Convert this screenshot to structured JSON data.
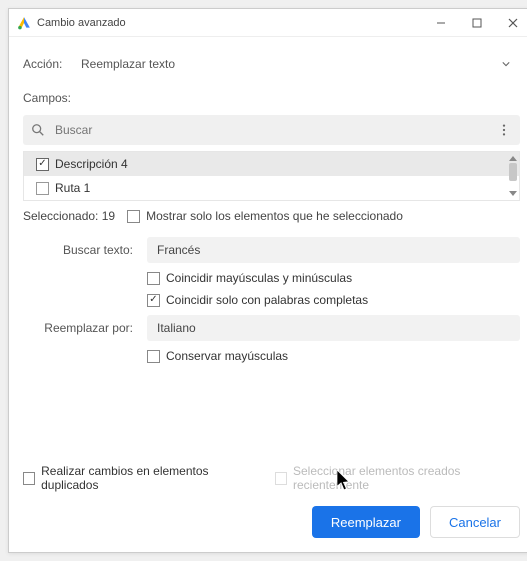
{
  "window": {
    "title": "Cambio avanzado"
  },
  "action": {
    "label": "Acción:",
    "value": "Reemplazar texto"
  },
  "fields": {
    "heading": "Campos:",
    "search_placeholder": "Buscar"
  },
  "list": {
    "items": [
      {
        "label": "Descripción 4",
        "checked": true
      },
      {
        "label": "Ruta 1",
        "checked": false
      }
    ]
  },
  "selection": {
    "count_label": "Seleccionado: 19",
    "show_only_label": "Mostrar solo los elementos que he seleccionado",
    "show_only_checked": false
  },
  "find": {
    "label": "Buscar texto:",
    "value": "Francés",
    "match_case_label": "Coincidir mayúsculas y minúsculas",
    "match_case_checked": false,
    "whole_word_label": "Coincidir solo con palabras completas",
    "whole_word_checked": true
  },
  "replace": {
    "label": "Reemplazar por:",
    "value": "Italiano",
    "preserve_case_label": "Conservar mayúsculas",
    "preserve_case_checked": false
  },
  "footer": {
    "dup_label": "Realizar cambios en elementos duplicados",
    "dup_checked": false,
    "recent_label": "Seleccionar elementos creados recientemente",
    "recent_checked": false
  },
  "buttons": {
    "primary": "Reemplazar",
    "secondary": "Cancelar"
  }
}
